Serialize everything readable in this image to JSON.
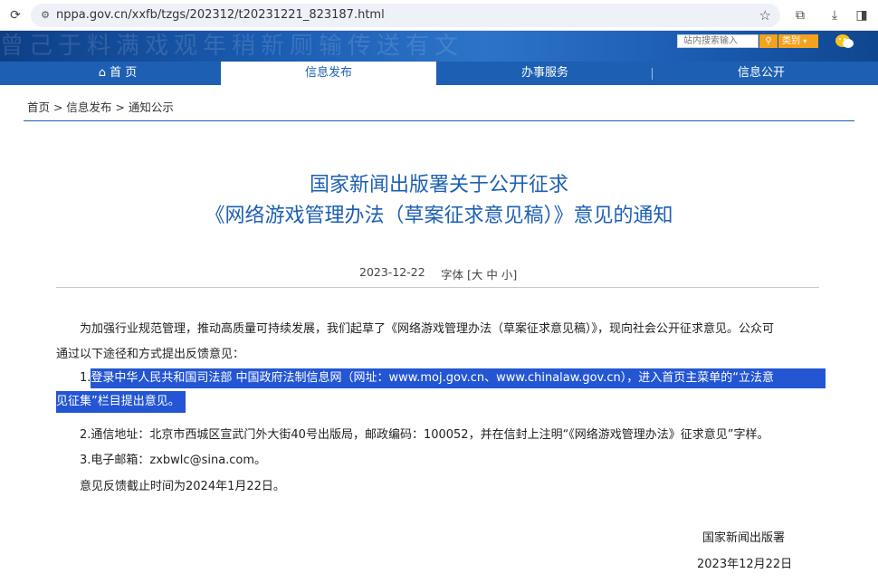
{
  "browser": {
    "url": "nppa.gov.cn/xxfb/tzgs/202312/t20231221_823187.html"
  },
  "header": {
    "banner_text": "曾己于料满戏观年稍新厕输传送有文",
    "search_placeholder": "站内搜索输入",
    "category_label": "类别",
    "nav": [
      {
        "label": "首 页"
      },
      {
        "label": "信息发布"
      },
      {
        "label": "办事服务"
      },
      {
        "label": "信息公开"
      }
    ]
  },
  "breadcrumb": "首页 > 信息发布 > 通知公示",
  "article": {
    "title_line1": "国家新闻出版署关于公开征求",
    "title_line2": "《网络游戏管理办法（草案征求意见稿）》意见的通知",
    "date": "2023-12-22",
    "font_label": "字体",
    "font_sizes": "[大 中 小]",
    "p1_line1": "为加强行业规范管理，推动高质量可持续发展，我们起草了《网络游戏管理办法（草案征求意见稿）》，现向社会公开征求意见。公众可",
    "p1_line2": "通过以下途径和方式提出反馈意见：",
    "item1_prefix": "1.",
    "item1_line1": "登录中华人民共和国司法部 中国政府法制信息网（网址：www.moj.gov.cn、www.chinalaw.gov.cn），进入首页主菜单的“立法意",
    "item1_line2": "见征集”栏目提出意见。",
    "item2": "2.通信地址：北京市西城区宣武门外大街40号出版局，邮政编码：100052，并在信封上注明“《网络游戏管理办法》征求意见”字样。",
    "item3": "3.电子邮箱：zxbwlc@sina.com。",
    "deadline": "意见反馈截止时间为2024年1月22日。",
    "signature_org": "国家新闻出版署",
    "signature_date": "2023年12月22日"
  },
  "colors": {
    "brand_blue": "#1d5fb3",
    "highlight": "#2456d3",
    "accent_orange": "#f3a21d"
  }
}
